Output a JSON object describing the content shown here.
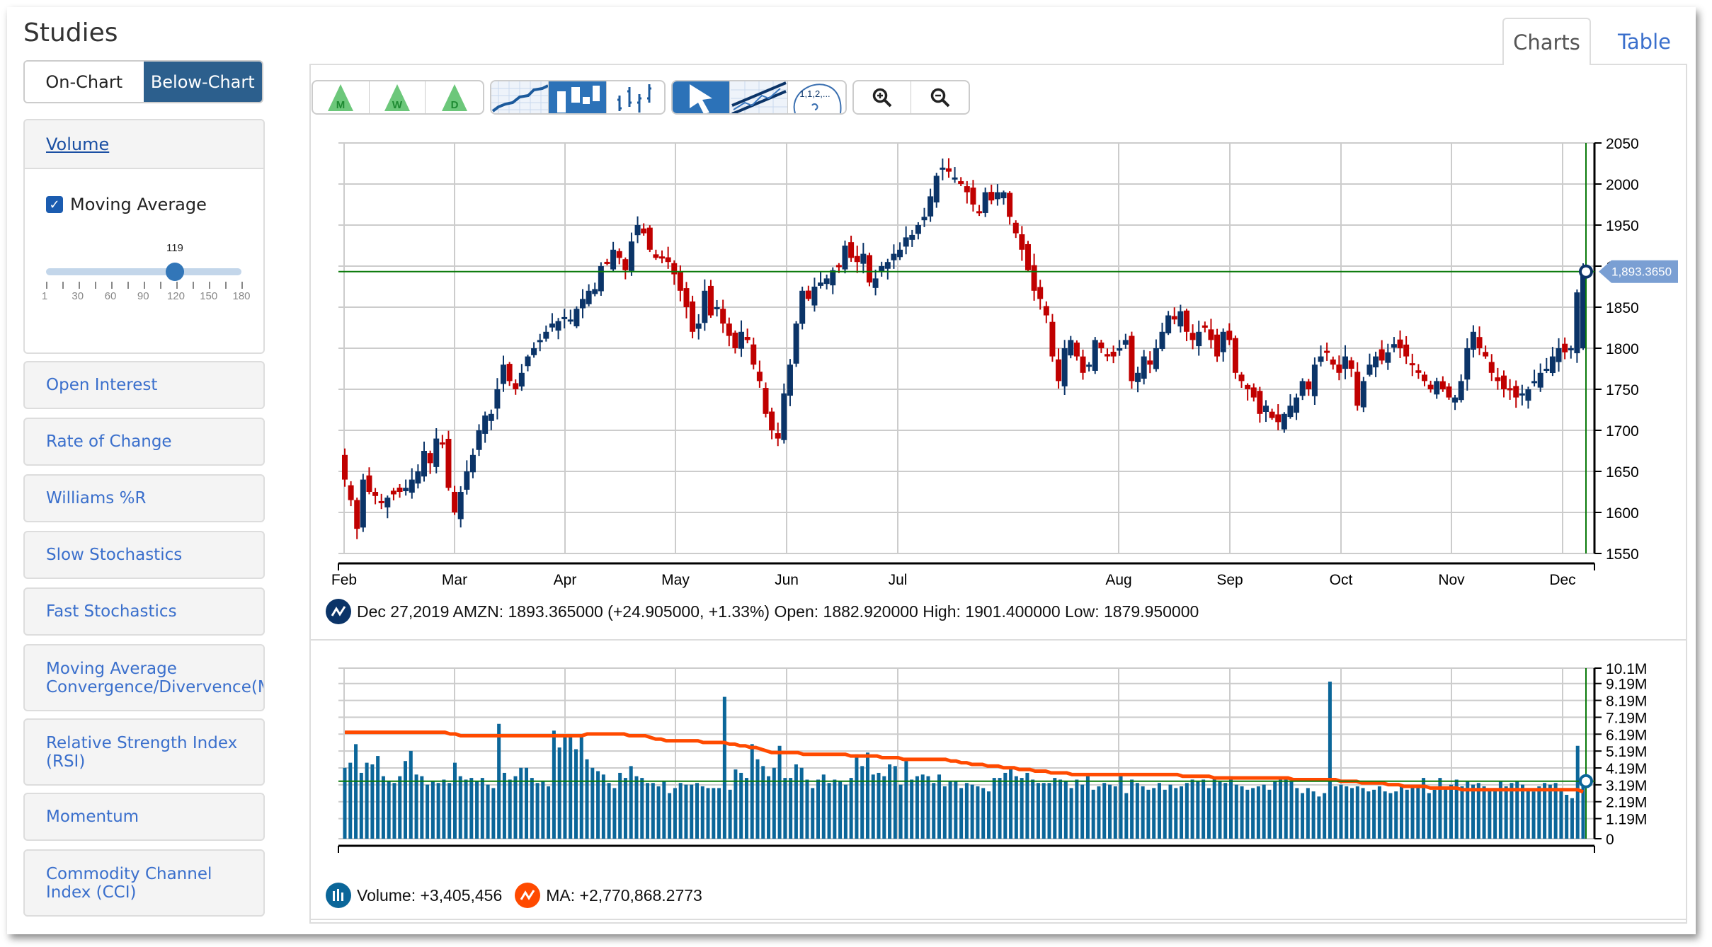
{
  "sidebar": {
    "title": "Studies",
    "toggle": {
      "on_chart": "On-Chart",
      "below_chart": "Below-Chart",
      "selected": "Below-Chart"
    },
    "volume_panel": {
      "title": "Volume",
      "moving_average_label": "Moving Average",
      "moving_average_checked": true,
      "slider": {
        "value": 119,
        "min": 1,
        "max": 180,
        "labels": [
          "1",
          "30",
          "60",
          "90",
          "120",
          "150",
          "180"
        ]
      }
    },
    "study_items": [
      "Open Interest",
      "Rate of Change",
      "Williams %R",
      "Slow Stochastics",
      "Fast Stochastics",
      "Moving Average\nConvergence/Divervence(MACD)",
      "Relative Strength Index\n(RSI)",
      "Momentum",
      "Commodity Channel\nIndex (CCI)"
    ]
  },
  "tabs": [
    {
      "label": "Charts",
      "active": true
    },
    {
      "label": "Table",
      "active": false
    }
  ],
  "toolbar": {
    "groups": [
      [
        {
          "name": "monthly-icon",
          "letter": "M"
        },
        {
          "name": "weekly-icon",
          "letter": "W"
        },
        {
          "name": "daily-icon",
          "letter": "D"
        }
      ],
      [
        {
          "name": "line-chart-icon"
        },
        {
          "name": "candlestick-chart-icon",
          "active": true
        },
        {
          "name": "ohlc-chart-icon"
        }
      ],
      [
        {
          "name": "pointer-icon",
          "active": true
        },
        {
          "name": "trendline-icon"
        },
        {
          "name": "fibonacci-icon",
          "label": "1,1,2,..."
        }
      ],
      [
        {
          "name": "zoom-in-icon"
        },
        {
          "name": "zoom-out-icon"
        }
      ]
    ]
  },
  "price_info": {
    "text": "Dec 27,2019 AMZN: 1893.365000 (+24.905000, +1.33%) Open: 1882.920000 High: 1901.400000 Low: 1879.950000",
    "current_price_label": "1,893.3650"
  },
  "volume_legend": {
    "volume_text": "Volume: +3,405,456",
    "ma_text": "MA: +2,770,868.2773"
  },
  "colors": {
    "up": "#0b3468",
    "down": "#c00000",
    "volume": "#0b6699",
    "ma": "#ff4a00",
    "crosshair": "#0a7a0a",
    "price_tag": "#7a9fd3"
  },
  "chart_data": [
    {
      "type": "candlestick",
      "title": "AMZN",
      "ylim": [
        1550,
        2050
      ],
      "yticks": [
        2050,
        2000,
        1950,
        1900,
        1850,
        1800,
        1750,
        1700,
        1650,
        1600,
        1550
      ],
      "ytick_labels": [
        "2050",
        "2000",
        "1950",
        "1900",
        "1850",
        "1800",
        "1750",
        "1700",
        "1650",
        "1600",
        "1550"
      ],
      "xtick_labels": [
        "Feb",
        "Mar",
        "Apr",
        "May",
        "Jun",
        "Jul",
        "Aug",
        "Sep",
        "Oct",
        "Nov",
        "Dec"
      ],
      "grid": true,
      "crosshair_value": 1893.365,
      "close_path": [
        1640,
        1615,
        1580,
        1640,
        1625,
        1620,
        1612,
        1618,
        1622,
        1625,
        1630,
        1640,
        1650,
        1675,
        1660,
        1690,
        1685,
        1630,
        1600,
        1625,
        1650,
        1670,
        1700,
        1718,
        1720,
        1750,
        1780,
        1760,
        1750,
        1770,
        1790,
        1800,
        1810,
        1820,
        1830,
        1833,
        1838,
        1835,
        1848,
        1860,
        1870,
        1872,
        1900,
        1905,
        1920,
        1910,
        1895,
        1930,
        1950,
        1940,
        1920,
        1910,
        1910,
        1905,
        1890,
        1870,
        1850,
        1820,
        1830,
        1870,
        1840,
        1850,
        1830,
        1815,
        1800,
        1820,
        1810,
        1780,
        1760,
        1720,
        1700,
        1690,
        1745,
        1780,
        1830,
        1870,
        1860,
        1875,
        1880,
        1885,
        1895,
        1900,
        1925,
        1910,
        1905,
        1915,
        1880,
        1885,
        1900,
        1905,
        1915,
        1920,
        1935,
        1938,
        1950,
        1960,
        1985,
        2010,
        2020,
        2015,
        2008,
        2000,
        1990,
        1975,
        1965,
        1990,
        1980,
        1990,
        1990,
        1960,
        1940,
        1920,
        1895,
        1870,
        1860,
        1840,
        1790,
        1760,
        1800,
        1810,
        1790,
        1770,
        1780,
        1810,
        1800,
        1790,
        1790,
        1800,
        1810,
        1760,
        1770,
        1790,
        1780,
        1800,
        1820,
        1840,
        1835,
        1845,
        1820,
        1810,
        1820,
        1825,
        1810,
        1790,
        1820,
        1810,
        1770,
        1760,
        1750,
        1740,
        1720,
        1730,
        1715,
        1710,
        1720,
        1730,
        1740,
        1760,
        1750,
        1780,
        1790,
        1795,
        1780,
        1770,
        1790,
        1775,
        1730,
        1760,
        1780,
        1790,
        1785,
        1795,
        1805,
        1800,
        1790,
        1780,
        1770,
        1760,
        1750,
        1760,
        1750,
        1740,
        1740,
        1760,
        1800,
        1820,
        1800,
        1790,
        1770,
        1760,
        1750,
        1750,
        1740,
        1745,
        1750,
        1760,
        1770,
        1775,
        1790,
        1800,
        1795,
        1800,
        1868,
        1893.365
      ]
    },
    {
      "type": "bar",
      "title": "Volume",
      "ylim": [
        0,
        10100000
      ],
      "ytick_labels": [
        "10.1M",
        "9.19M",
        "8.19M",
        "7.19M",
        "6.19M",
        "5.19M",
        "4.19M",
        "3.19M",
        "2.19M",
        "1.19M",
        "0"
      ],
      "grid": true,
      "series": [
        {
          "name": "Volume",
          "values_millions": [
            4.2,
            4.5,
            5.6,
            3.9,
            4.5,
            4.4,
            4.9,
            3.7,
            3.4,
            3.3,
            3.7,
            4.6,
            5.2,
            3.8,
            3.7,
            3.2,
            3.4,
            3.3,
            3.5,
            3.3,
            4.5,
            3.7,
            3.5,
            3.6,
            3.4,
            3.6,
            3.2,
            3.0,
            6.8,
            3.9,
            3.5,
            3.7,
            4.2,
            4.2,
            3.6,
            3.3,
            3.4,
            3.1,
            6.4,
            5.4,
            6.2,
            6.2,
            5.3,
            6.1,
            4.7,
            4.2,
            4.0,
            3.8,
            3.3,
            3.0,
            3.9,
            3.6,
            4.3,
            3.7,
            3.6,
            3.3,
            3.3,
            3.1,
            3.4,
            2.7,
            3.0,
            3.3,
            3.2,
            3.2,
            3.3,
            3.1,
            3.0,
            3.0,
            3.0,
            8.4,
            2.9,
            4.1,
            3.9,
            3.6,
            5.6,
            4.7,
            4.3,
            3.7,
            4.2,
            5.5,
            3.6,
            3.6,
            4.4,
            4.2,
            3.5,
            3.0,
            3.5,
            3.8,
            3.3,
            3.5,
            3.4,
            3.2,
            3.6,
            5.0,
            4.3,
            5.1,
            3.8,
            3.9,
            3.7,
            4.4,
            4.3,
            3.2,
            4.6,
            3.5,
            3.7,
            3.8,
            3.7,
            3.3,
            3.8,
            3.1,
            3.4,
            3.4,
            3.0,
            3.3,
            3.2,
            3.1,
            3.0,
            2.8,
            3.6,
            3.6,
            3.9,
            4.2,
            3.7,
            3.6,
            3.9,
            3.5,
            3.3,
            3.3,
            3.3,
            3.6,
            3.5,
            3.4,
            3.0,
            3.5,
            3.2,
            3.7,
            2.9,
            3.1,
            3.3,
            3.2,
            3.1,
            3.7,
            2.7,
            3.5,
            3.3,
            3.1,
            2.9,
            3.0,
            3.3,
            2.9,
            3.2,
            3.0,
            3.1,
            3.3,
            3.5,
            3.4,
            3.5,
            3.0,
            3.6,
            3.4,
            3.3,
            3.7,
            3.2,
            3.1,
            2.9,
            3.0,
            3.1,
            3.2,
            2.9,
            3.4,
            3.5,
            3.5,
            3.4,
            3.0,
            2.7,
            3.0,
            2.8,
            2.5,
            2.7,
            9.3,
            3.1,
            3.2,
            3.1,
            3.0,
            3.1,
            3.0,
            2.8,
            2.9,
            3.1,
            2.8,
            2.7,
            2.8,
            3.2,
            2.9,
            3.1,
            3.0,
            3.6,
            2.7,
            2.9,
            3.6,
            3.1,
            3.2,
            3.5,
            3.1,
            3.4,
            3.2,
            3.3,
            3.1,
            2.9,
            3.0,
            3.4,
            3.1,
            3.3,
            3.4,
            3.2,
            3.0,
            2.8,
            3.1,
            3.3,
            3.2,
            3.3,
            3.0,
            2.6,
            2.4,
            5.5,
            3.4
          ]
        },
        {
          "name": "MA",
          "type": "line",
          "values_millions": [
            6.3,
            6.3,
            6.3,
            6.3,
            6.3,
            6.3,
            6.3,
            6.3,
            6.3,
            6.3,
            6.3,
            6.3,
            6.3,
            6.3,
            6.3,
            6.3,
            6.3,
            6.3,
            6.3,
            6.3,
            6.2,
            6.2,
            6.1,
            6.1,
            6.1,
            6.1,
            6.1,
            6.1,
            6.1,
            6.1,
            6.1,
            6.1,
            6.1,
            6.1,
            6.1,
            6.1,
            6.1,
            6.1,
            6.1,
            6.1,
            6.1,
            6.1,
            6.1,
            6.1,
            6.1,
            6.1,
            6.2,
            6.2,
            6.2,
            6.2,
            6.2,
            6.2,
            6.2,
            6.2,
            6.1,
            6.1,
            6.1,
            6.1,
            6.0,
            5.9,
            5.9,
            5.8,
            5.8,
            5.8,
            5.8,
            5.8,
            5.8,
            5.8,
            5.7,
            5.7,
            5.7,
            5.7,
            5.7,
            5.6,
            5.6,
            5.5,
            5.5,
            5.4,
            5.4,
            5.3,
            5.2,
            5.1,
            5.1,
            5.1,
            5.1,
            5.1,
            5.1,
            5.0,
            5.0,
            5.0,
            5.0,
            5.0,
            5.0,
            5.0,
            5.0,
            5.0,
            4.9,
            4.9,
            4.9,
            4.9,
            4.9,
            4.9,
            4.8,
            4.8,
            4.8,
            4.8,
            4.7,
            4.7,
            4.7,
            4.7,
            4.7,
            4.7,
            4.7,
            4.7,
            4.7,
            4.6,
            4.6,
            4.5,
            4.5,
            4.4,
            4.4,
            4.4,
            4.3,
            4.3,
            4.3,
            4.2,
            4.2,
            4.2,
            4.1,
            4.1,
            4.1,
            4.0,
            4.0,
            4.0,
            3.9,
            3.9,
            3.9,
            3.9,
            3.8,
            3.8,
            3.8,
            3.8,
            3.8,
            3.8,
            3.8,
            3.8,
            3.8,
            3.8,
            3.8,
            3.8,
            3.8,
            3.8,
            3.8,
            3.8,
            3.8,
            3.8,
            3.8,
            3.8,
            3.8,
            3.7,
            3.7,
            3.7,
            3.7,
            3.7,
            3.7,
            3.6,
            3.6,
            3.6,
            3.6,
            3.6,
            3.6,
            3.6,
            3.6,
            3.6,
            3.6,
            3.6,
            3.6,
            3.6,
            3.6,
            3.6,
            3.5,
            3.5,
            3.5,
            3.5,
            3.5,
            3.5,
            3.5,
            3.5,
            3.5,
            3.4,
            3.4,
            3.4,
            3.4,
            3.3,
            3.3,
            3.3,
            3.3,
            3.3,
            3.2,
            3.2,
            3.2,
            3.1,
            3.1,
            3.1,
            3.1,
            3.1,
            3.0,
            3.0,
            3.0,
            3.0,
            3.0,
            3.0,
            2.9,
            2.9,
            2.9,
            2.9,
            2.9,
            2.9,
            2.9,
            2.9,
            2.9,
            2.9,
            2.9,
            2.9,
            2.9,
            2.9,
            2.9,
            2.9,
            2.9,
            2.9,
            2.9,
            2.9,
            2.9,
            2.9,
            2.9,
            2.77
          ]
        }
      ],
      "crosshair_value_millions": 3.405456
    }
  ]
}
